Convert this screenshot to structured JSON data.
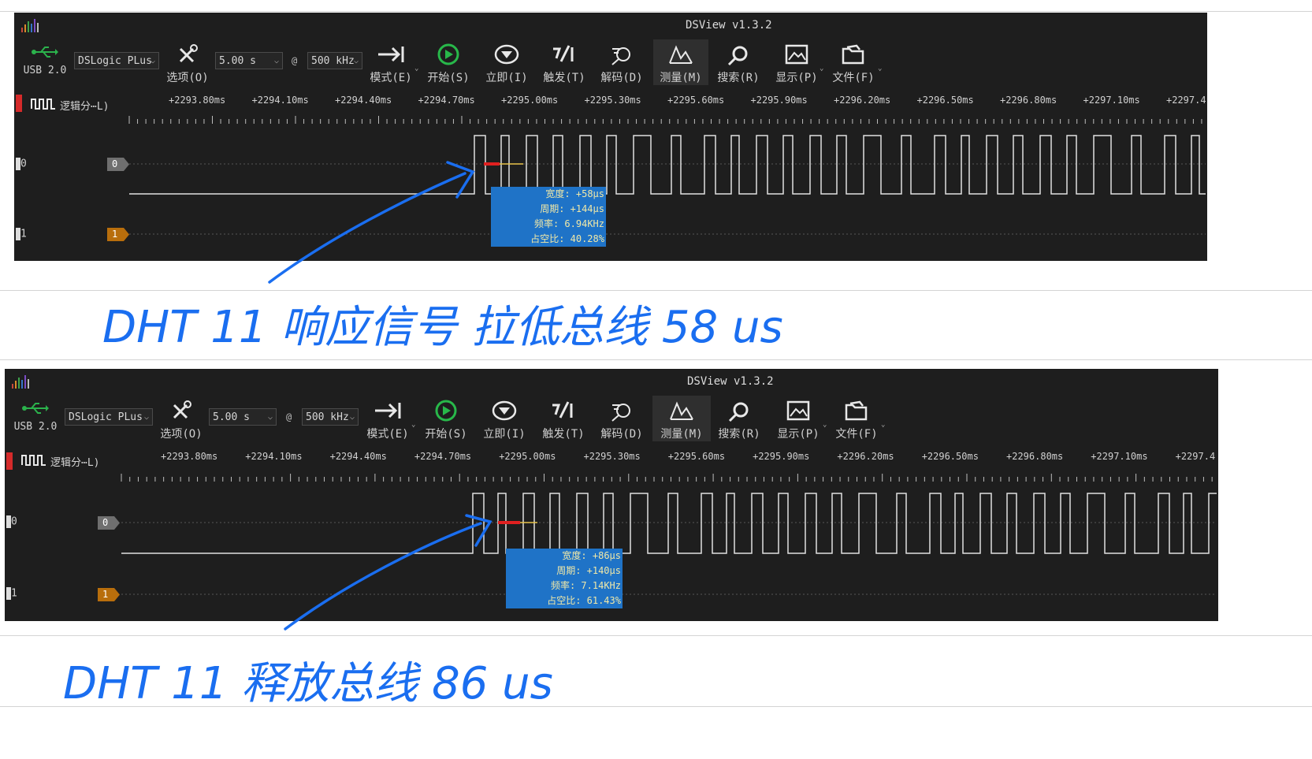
{
  "panels": [
    {
      "app_title": "DSView v1.3.2",
      "usb_label": "USB 2.0",
      "device": "DSLogic PLus",
      "duration": "5.00 s",
      "at_symbol": "@",
      "samplerate": "500 kHz",
      "toolbar": {
        "options": "选项(O)",
        "mode": "模式(E)",
        "start": "开始(S)",
        "instant": "立即(I)",
        "trigger": "触发(T)",
        "decode": "解码(D)",
        "measure": "测量(M)",
        "search": "搜索(R)",
        "display": "显示(P)",
        "file": "文件(F)"
      },
      "group_label": "逻辑分⋯L)",
      "time_labels": [
        "+2293.80ms",
        "+2294.10ms",
        "+2294.40ms",
        "+2294.70ms",
        "+2295.00ms",
        "+2295.30ms",
        "+2295.60ms",
        "+2295.90ms",
        "+2296.20ms",
        "+2296.50ms",
        "+2296.80ms",
        "+2297.10ms",
        "+2297.4"
      ],
      "channels": [
        {
          "index": "0",
          "badge": "0",
          "badge_color": "#6f6f6f"
        },
        {
          "index": "1",
          "badge": "1",
          "badge_color": "#b86e0c"
        }
      ],
      "measurement": {
        "width": "宽度: +58μs",
        "period": "周期: +144μs",
        "frequency": "频率: 6.94KHz",
        "duty": "占空比: 40.28%"
      }
    },
    {
      "app_title": "DSView v1.3.2",
      "usb_label": "USB 2.0",
      "device": "DSLogic PLus",
      "duration": "5.00 s",
      "at_symbol": "@",
      "samplerate": "500 kHz",
      "toolbar": {
        "options": "选项(O)",
        "mode": "模式(E)",
        "start": "开始(S)",
        "instant": "立即(I)",
        "trigger": "触发(T)",
        "decode": "解码(D)",
        "measure": "测量(M)",
        "search": "搜索(R)",
        "display": "显示(P)",
        "file": "文件(F)"
      },
      "group_label": "逻辑分⋯L)",
      "time_labels": [
        "+2293.80ms",
        "+2294.10ms",
        "+2294.40ms",
        "+2294.70ms",
        "+2295.00ms",
        "+2295.30ms",
        "+2295.60ms",
        "+2295.90ms",
        "+2296.20ms",
        "+2296.50ms",
        "+2296.80ms",
        "+2297.10ms",
        "+2297.4"
      ],
      "channels": [
        {
          "index": "0",
          "badge": "0",
          "badge_color": "#6f6f6f"
        },
        {
          "index": "1",
          "badge": "1",
          "badge_color": "#b86e0c"
        }
      ],
      "measurement": {
        "width": "宽度: +86μs",
        "period": "周期: +140μs",
        "frequency": "频率: 7.14KHz",
        "duty": "占空比: 61.43%"
      }
    }
  ],
  "notes": {
    "note1": "DHT 11 响应信号    拉低总线 58 us",
    "note2": "DHT 11 释放总线    86 us"
  },
  "colors": {
    "ink": "#1a6ef0",
    "accent_green": "#28b84a",
    "measure_box": "#1f73c7",
    "cursor_red": "#e02020"
  }
}
